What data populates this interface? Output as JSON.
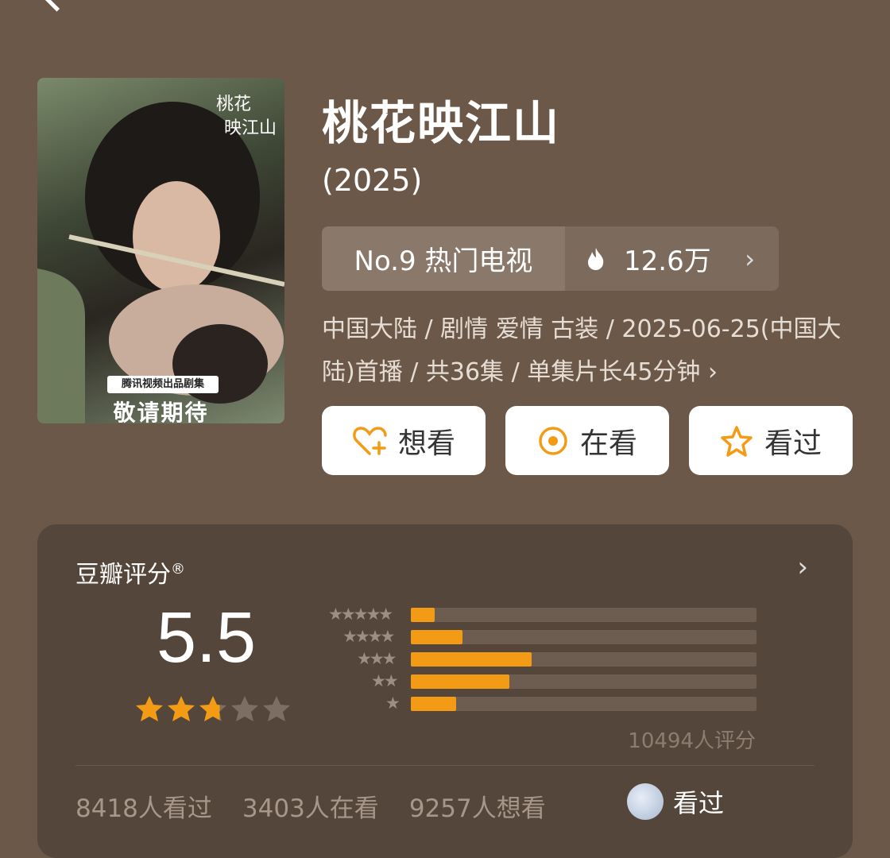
{
  "title": "桃花映江山",
  "year": "(2025)",
  "rank": {
    "label": "No.9 热门电视",
    "heat": "12.6万"
  },
  "meta": "中国大陆 / 剧情 爱情 古装 / 2025-06-25(中国大陆)首播 / 共36集 / 单集片长45分钟 ›",
  "poster": {
    "badge": "腾讯视频出品剧集",
    "tagline": "敬请期待"
  },
  "actions": {
    "want": "想看",
    "watching": "在看",
    "watched": "看过"
  },
  "rating": {
    "label": "豆瓣评分",
    "mark": "®",
    "score": "5.5",
    "stars": 2.75,
    "count": "10494人评分",
    "distribution": [
      {
        "stars": "★★★★★",
        "fraction": 0.07
      },
      {
        "stars": "★★★★",
        "fraction": 0.15
      },
      {
        "stars": "★★★",
        "fraction": 0.35
      },
      {
        "stars": "★★",
        "fraction": 0.285
      },
      {
        "stars": "★",
        "fraction": 0.13
      }
    ]
  },
  "stats": {
    "watched": "8418人看过",
    "watching": "3403人在看",
    "want": "9257人想看"
  },
  "seen_button": "看过",
  "colors": {
    "accent": "#f39b14",
    "background": "#6b5848",
    "panel": "#54463a"
  },
  "icons": [
    "back-icon",
    "flame-icon",
    "chevron-right-icon",
    "heart-plus-icon",
    "target-icon",
    "star-outline-icon",
    "star-icon"
  ]
}
